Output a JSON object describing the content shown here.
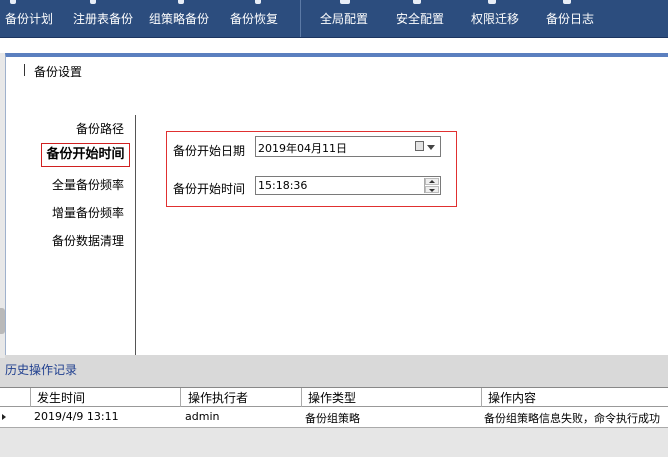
{
  "toolbar": {
    "items": [
      "备份计划",
      "注册表备份",
      "组策略备份",
      "备份恢复",
      "全局配置",
      "安全配置",
      "权限迁移",
      "备份日志"
    ]
  },
  "panel": {
    "title": "备份设置"
  },
  "nav": {
    "items": [
      "备份路径",
      "备份开始时间",
      "全量备份频率",
      "增量备份频率",
      "备份数据清理"
    ],
    "selected_index": 1
  },
  "form": {
    "start_date_label": "备份开始日期",
    "start_date_value": "2019年04月11日",
    "start_time_label": "备份开始时间",
    "start_time_value": "15:18:36"
  },
  "history": {
    "title": "历史操作记录",
    "columns": [
      "发生时间",
      "操作执行者",
      "操作类型",
      "操作内容"
    ],
    "rows": [
      [
        "2019/4/9 13:11",
        "admin",
        "备份组策略",
        "备份组策略信息失败，命令执行成功"
      ]
    ]
  },
  "colors": {
    "toolbar_bg": "#2c4d7e",
    "highlight_border": "#e03030",
    "panel_accent": "#5b7fbf",
    "history_title": "#1f3f8f"
  }
}
